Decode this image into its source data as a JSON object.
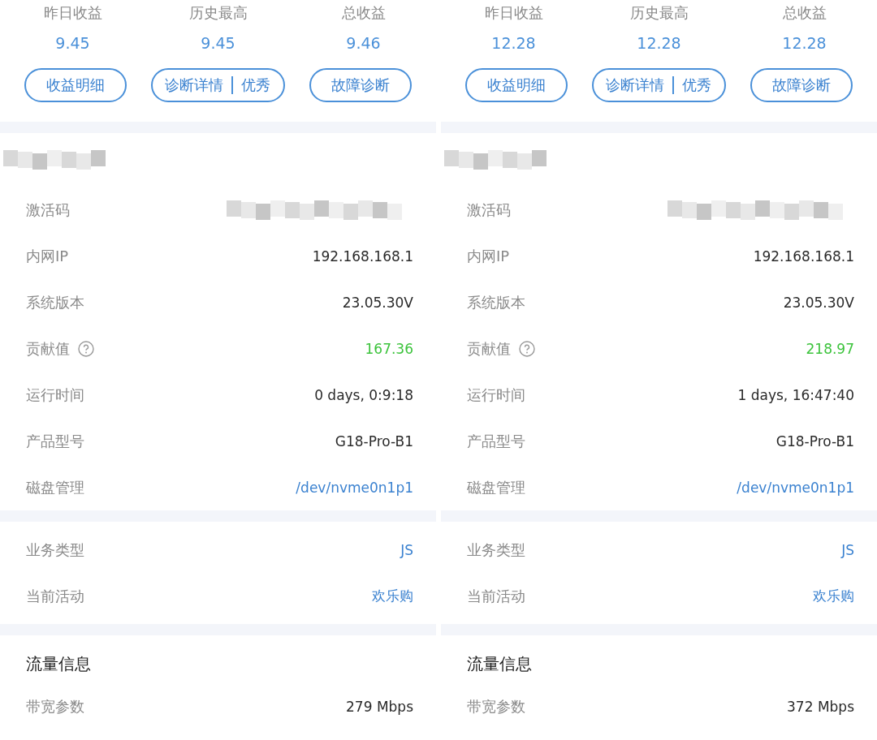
{
  "panels": [
    {
      "stats": [
        {
          "label": "昨日收益",
          "value": "9.45"
        },
        {
          "label": "历史最高",
          "value": "9.45"
        },
        {
          "label": "总收益",
          "value": "9.46"
        }
      ],
      "buttons": [
        {
          "kind": "plain",
          "label": "收益明细"
        },
        {
          "kind": "split",
          "label": "诊断详情",
          "grade": "优秀"
        },
        {
          "kind": "plain",
          "label": "故障诊断"
        }
      ],
      "device_rows": [
        {
          "label": "激活码",
          "kind": "masked"
        },
        {
          "label": "内网IP",
          "value": "192.168.168.1",
          "kind": "normal"
        },
        {
          "label": "系统版本",
          "value": "23.05.30V",
          "kind": "normal"
        },
        {
          "label": "贡献值",
          "value": "167.36",
          "kind": "positive",
          "help": true
        },
        {
          "label": "运行时间",
          "value": "0 days, 0:9:18",
          "kind": "normal"
        },
        {
          "label": "产品型号",
          "value": "G18-Pro-B1",
          "kind": "normal"
        },
        {
          "label": "磁盘管理",
          "value": "/dev/nvme0n1p1",
          "kind": "link"
        }
      ],
      "business_rows": [
        {
          "label": "业务类型",
          "value": "JS",
          "kind": "link"
        },
        {
          "label": "当前活动",
          "value": "欢乐购",
          "kind": "link"
        }
      ],
      "traffic": {
        "title": "流量信息",
        "rows": [
          {
            "label": "带宽参数",
            "value": "279 Mbps",
            "kind": "normal"
          }
        ]
      }
    },
    {
      "stats": [
        {
          "label": "昨日收益",
          "value": "12.28"
        },
        {
          "label": "历史最高",
          "value": "12.28"
        },
        {
          "label": "总收益",
          "value": "12.28"
        }
      ],
      "buttons": [
        {
          "kind": "plain",
          "label": "收益明细"
        },
        {
          "kind": "split",
          "label": "诊断详情",
          "grade": "优秀"
        },
        {
          "kind": "plain",
          "label": "故障诊断"
        }
      ],
      "device_rows": [
        {
          "label": "激活码",
          "kind": "masked"
        },
        {
          "label": "内网IP",
          "value": "192.168.168.1",
          "kind": "normal"
        },
        {
          "label": "系统版本",
          "value": "23.05.30V",
          "kind": "normal"
        },
        {
          "label": "贡献值",
          "value": "218.97",
          "kind": "positive",
          "help": true
        },
        {
          "label": "运行时间",
          "value": "1 days, 16:47:40",
          "kind": "normal"
        },
        {
          "label": "产品型号",
          "value": "G18-Pro-B1",
          "kind": "normal"
        },
        {
          "label": "磁盘管理",
          "value": "/dev/nvme0n1p1",
          "kind": "link"
        }
      ],
      "business_rows": [
        {
          "label": "业务类型",
          "value": "JS",
          "kind": "link"
        },
        {
          "label": "当前活动",
          "value": "欢乐购",
          "kind": "link"
        }
      ],
      "traffic": {
        "title": "流量信息",
        "rows": [
          {
            "label": "带宽参数",
            "value": "372 Mbps",
            "kind": "normal"
          }
        ]
      }
    }
  ]
}
